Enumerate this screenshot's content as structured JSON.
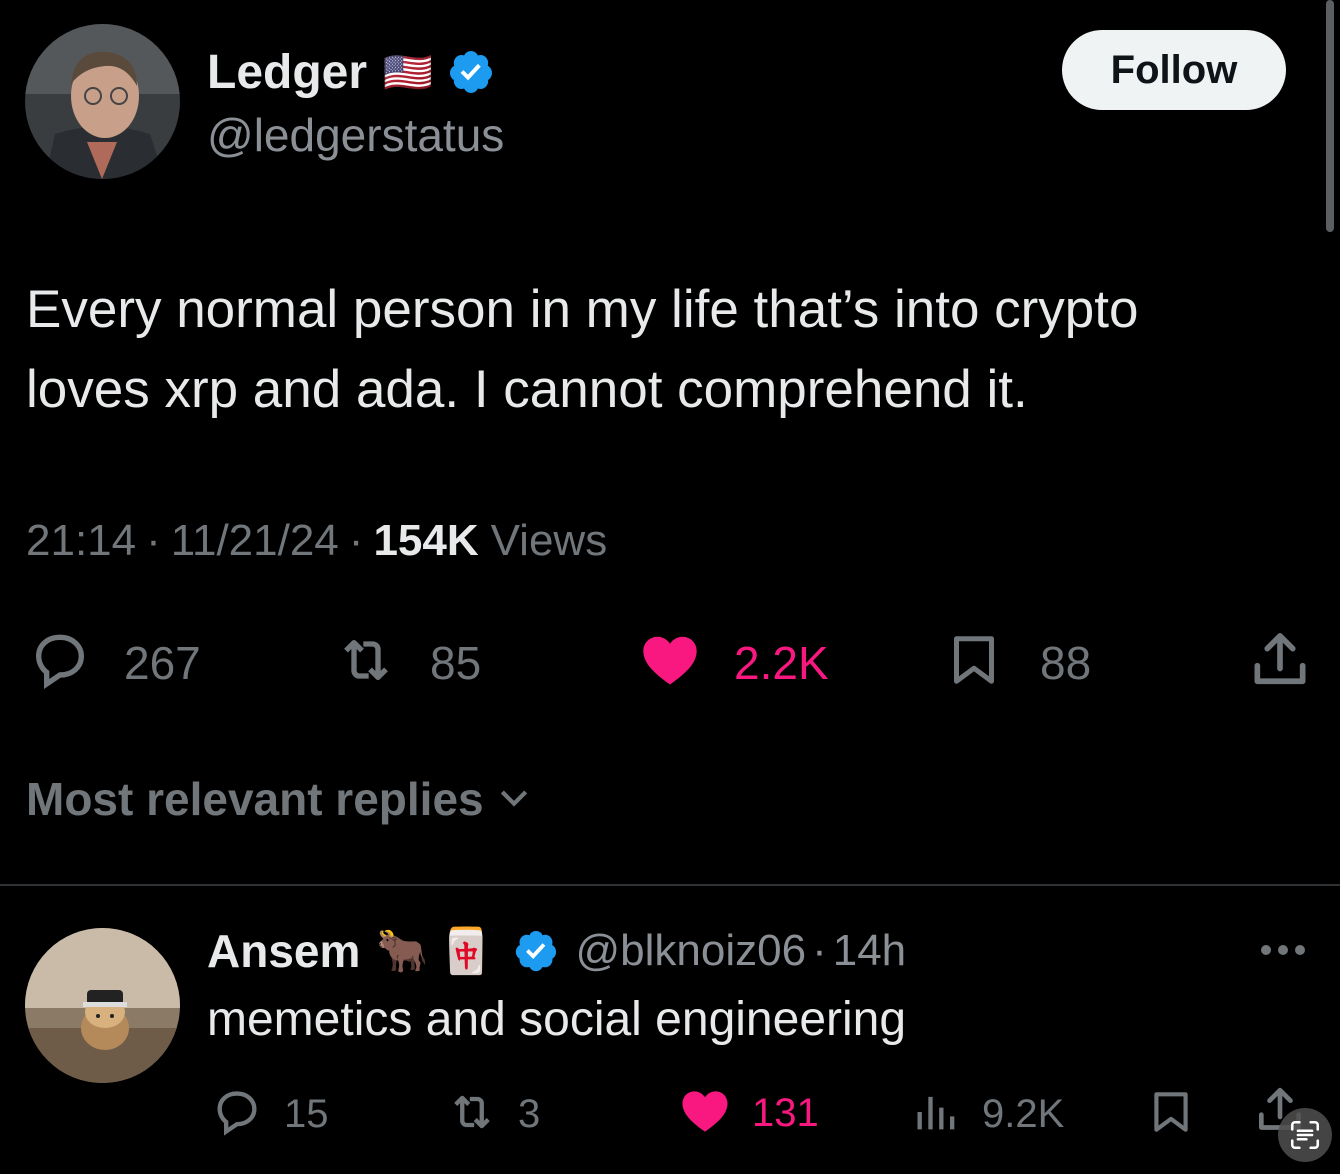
{
  "colors": {
    "accent": "#1d9bf0",
    "like": "#f91880",
    "muted": "#71767b",
    "text": "#e7e9ea"
  },
  "tweet": {
    "author_name": "Ledger",
    "flag": "🇺🇸",
    "handle": "@ledgerstatus",
    "verified": true,
    "follow_label": "Follow",
    "text_line1": "Every normal person in my life that’s into crypto",
    "text_line2": "loves xrp and ada. I cannot comprehend it.",
    "time": "21:14",
    "date": "11/21/24",
    "separator": "·",
    "views_count": "154K",
    "views_label": "Views",
    "replies": "267",
    "reposts": "85",
    "likes": "2.2K",
    "liked": true,
    "bookmarks": "88"
  },
  "sort": {
    "label": "Most relevant replies"
  },
  "reply": {
    "author_name": "Ansem",
    "emoji1": "🐂",
    "emoji2": "🀄",
    "handle": "@blknoiz06",
    "separator": "·",
    "time": "14h",
    "text": "memetics and social engineering",
    "replies": "15",
    "reposts": "3",
    "likes": "131",
    "liked": true,
    "views": "9.2K"
  }
}
